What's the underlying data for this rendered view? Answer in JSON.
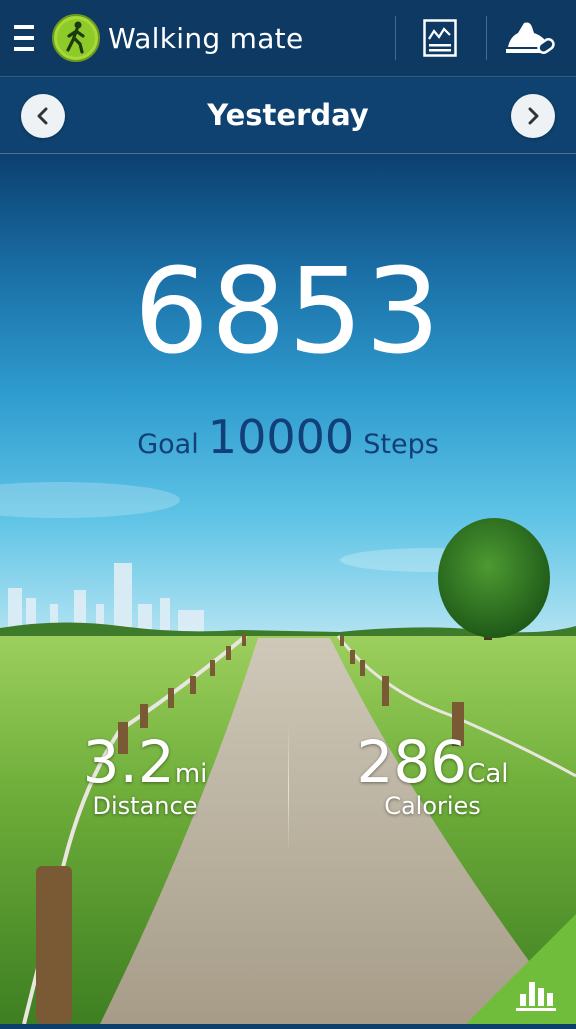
{
  "header": {
    "menu_icon": "hamburger-menu-icon",
    "logo_icon": "walker-icon",
    "title": "Walking mate",
    "actions": [
      {
        "icon": "chart-report-icon"
      },
      {
        "icon": "shoe-device-icon"
      }
    ]
  },
  "date_nav": {
    "label": "Yesterday",
    "prev_icon": "chevron-left-icon",
    "next_icon": "chevron-right-icon"
  },
  "steps": {
    "count": "6853",
    "goal_prefix": "Goal",
    "goal_value": "10000",
    "goal_suffix": "Steps"
  },
  "stats": {
    "distance": {
      "value": "3.2",
      "unit": "mi",
      "label": "Distance"
    },
    "calories": {
      "value": "286",
      "unit": "Cal",
      "label": "Calories"
    }
  },
  "corner": {
    "icon": "bar-chart-icon"
  },
  "colors": {
    "header_bg": "#0d3963",
    "goal_text": "#123f78",
    "corner_green": "#6fbd3a"
  }
}
